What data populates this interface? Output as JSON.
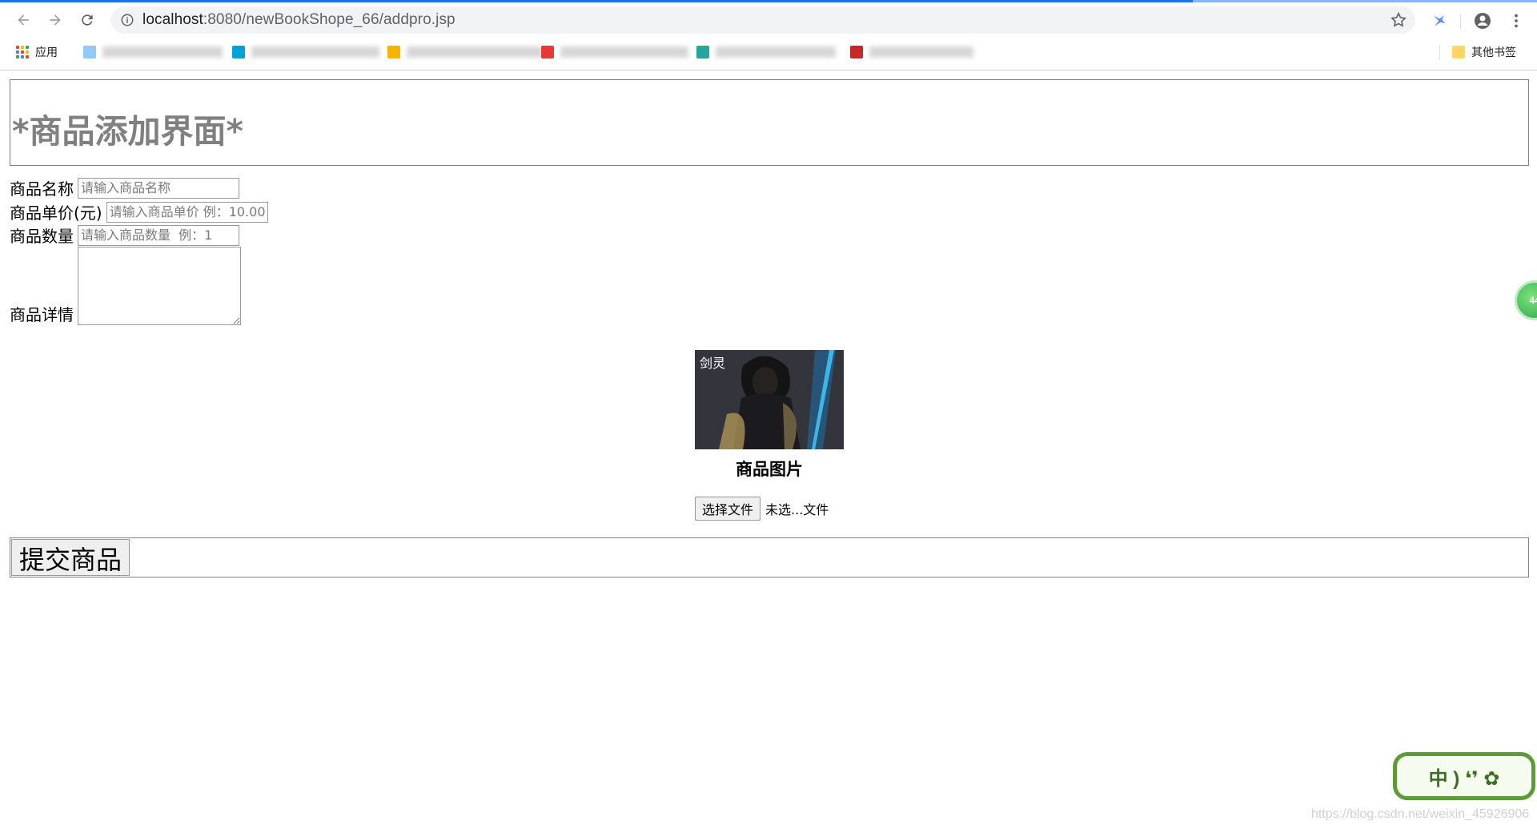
{
  "browser": {
    "url_host": "localhost",
    "url_path": ":8080/newBookShope_66/addpro.jsp",
    "bookmarks": [
      {
        "label": "应用",
        "icon": "apps-grid-icon",
        "color": "#4285f4"
      },
      {
        "label": "微信小程",
        "icon": "bookmark-favicon",
        "color": "#90caf9"
      },
      {
        "label": "哔哩哔哩 ( ゜- ゜)つ",
        "icon": "bilibili-icon",
        "color": "#00a1d6"
      },
      {
        "label": "系统 数字管理...",
        "icon": "bookmark-favicon",
        "color": "#f4b400"
      },
      {
        "label": "为什么py...",
        "icon": "csdn-icon",
        "color": "#e53935"
      },
      {
        "label": "",
        "icon": "bookmark-favicon",
        "color": "#26a69a"
      },
      {
        "label": "CSDN",
        "icon": "csdn-icon",
        "color": "#c62828"
      }
    ],
    "other_bookmarks": "其他书签"
  },
  "page": {
    "title": "*商品添加界面*",
    "fields": {
      "name": {
        "label": "商品名称",
        "placeholder": "请输入商品名称"
      },
      "price": {
        "label": "商品单价(元)",
        "placeholder": "请输入商品单价 例：10.00"
      },
      "quantity": {
        "label": "商品数量",
        "placeholder": "请输入商品数量  例：1"
      },
      "detail": {
        "label": "商品详情"
      }
    },
    "image_caption": "商品图片",
    "image_text": "剑灵",
    "file_button": "选择文件",
    "file_status": "未选...文件",
    "submit_label": "提交商品",
    "side_orb_text": "44",
    "corner_widget_text": "中 ) ❛❜ ✿"
  },
  "watermark": "https://blog.csdn.net/weixin_45926906",
  "colors": {
    "title_gray": "#808080",
    "loading_bar": "#1a73e8",
    "widget_green": "#5d9b3a"
  }
}
